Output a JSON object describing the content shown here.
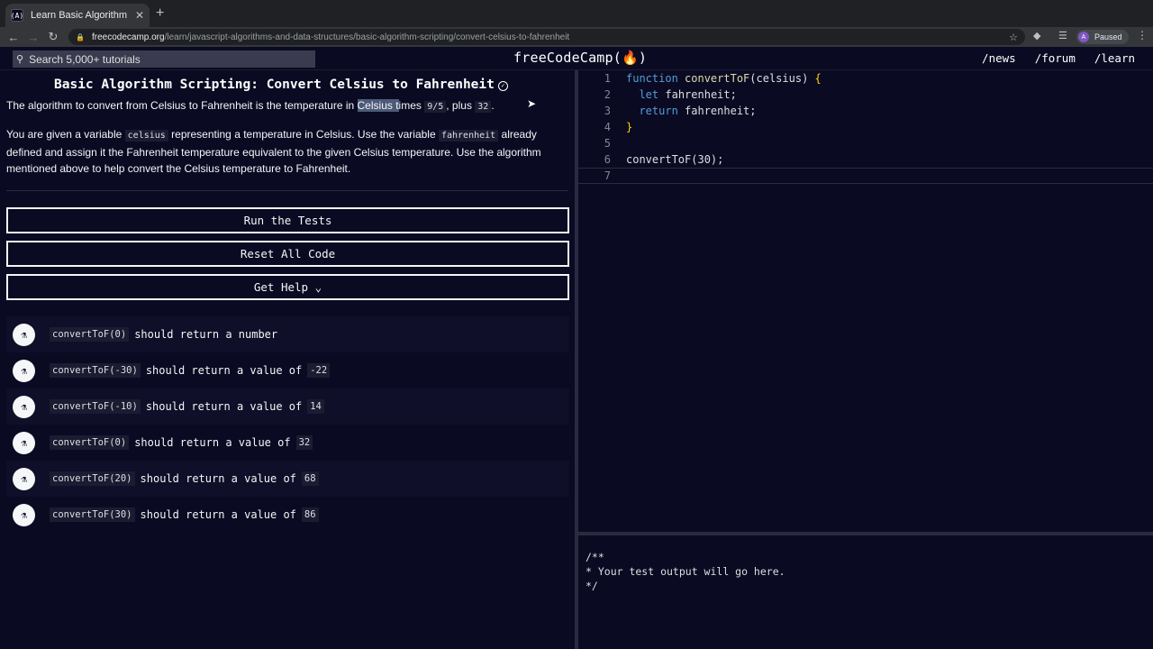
{
  "browser": {
    "tab_title": "Learn Basic Algorithm Scriptin",
    "tab_favicon": "(A)",
    "url_host": "freecodecamp.org",
    "url_path": "/learn/javascript-algorithms-and-data-structures/basic-algorithm-scripting/convert-celsius-to-fahrenheit",
    "profile_initial": "A",
    "profile_status": "Paused"
  },
  "nav": {
    "search_placeholder": "Search 5,000+ tutorials",
    "logo": "freeCodeCamp(🔥)",
    "links": [
      "/news",
      "/forum",
      "/learn"
    ]
  },
  "challenge": {
    "title": "Basic Algorithm Scripting: Convert Celsius to Fahrenheit",
    "p1_before": "The algorithm to convert from Celsius to Fahrenheit is the temperature in ",
    "p1_highlight": "Celsius t",
    "p1_after1": "imes ",
    "p1_code1": "9/5",
    "p1_after2": ", plus ",
    "p1_code2": "32",
    "p1_end": ".",
    "p2_a": "You are given a variable ",
    "p2_code1": "celsius",
    "p2_b": " representing a temperature in Celsius. Use the variable ",
    "p2_code2": "fahrenheit",
    "p2_c": " already defined and assign it the Fahrenheit temperature equivalent to the given Celsius temperature. Use the algorithm mentioned above to help convert the Celsius temperature to Fahrenheit."
  },
  "buttons": {
    "run": "Run the Tests",
    "reset": "Reset All Code",
    "help": "Get Help ⌄"
  },
  "tests": [
    {
      "code": "convertToF(0)",
      "text": "should return a number",
      "value": ""
    },
    {
      "code": "convertToF(-30)",
      "text": "should return a value of",
      "value": "-22"
    },
    {
      "code": "convertToF(-10)",
      "text": "should return a value of",
      "value": "14"
    },
    {
      "code": "convertToF(0)",
      "text": "should return a value of",
      "value": "32"
    },
    {
      "code": "convertToF(20)",
      "text": "should return a value of",
      "value": "68"
    },
    {
      "code": "convertToF(30)",
      "text": "should return a value of",
      "value": "86"
    }
  ],
  "editor": {
    "line_numbers": [
      "1",
      "2",
      "3",
      "4",
      "5",
      "6",
      "7"
    ],
    "l1_kw": "function",
    "l1_fn": "convertToF",
    "l1_params": "(celsius) ",
    "l1_brace": "{",
    "l2_kw": "let",
    "l2_rest": " fahrenheit;",
    "l3_kw": "return",
    "l3_rest": " fahrenheit;",
    "l4_brace": "}",
    "l6_fn": "convertToF",
    "l6_rest": "(30);"
  },
  "output": {
    "text": "/**\n* Your test output will go here.\n*/"
  }
}
